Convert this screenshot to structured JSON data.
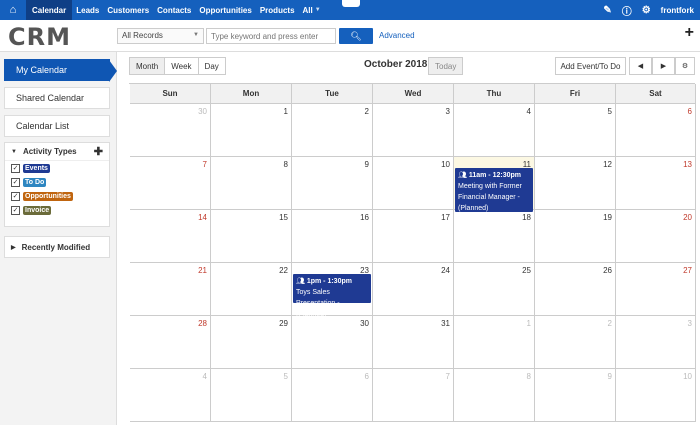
{
  "topnav": {
    "tabs": [
      {
        "label": "Calendar",
        "active": true
      },
      {
        "label": "Leads"
      },
      {
        "label": "Customers"
      },
      {
        "label": "Contacts"
      },
      {
        "label": "Opportunities"
      },
      {
        "label": "Products"
      },
      {
        "label": "All"
      }
    ],
    "user": "frontfork",
    "color": "#1560bd"
  },
  "header": {
    "logo": "CRM",
    "record_filter": "All Records",
    "search_placeholder": "Type keyword and press enter",
    "advanced_label": "Advanced"
  },
  "sidebar": {
    "buttons": [
      "My Calendar",
      "Shared Calendar",
      "Calendar List"
    ],
    "activity_types_title": "Activity Types",
    "activity_types": [
      {
        "label": "Events",
        "color": "#1f3a93",
        "checked": true
      },
      {
        "label": "To Do",
        "color": "#2e86c1",
        "checked": true
      },
      {
        "label": "Opportunities",
        "color": "#c0650f",
        "checked": true
      },
      {
        "label": "Invoice",
        "color": "#6b6b3a",
        "checked": true
      }
    ],
    "recently_modified": "Recently Modified"
  },
  "toolbar": {
    "views": [
      "Month",
      "Week",
      "Day"
    ],
    "active_view": "Month",
    "title": "October 2018",
    "today_label": "Today",
    "add_label": "Add Event/To Do",
    "prev": "◀",
    "next": "▶",
    "gear": "⚙"
  },
  "calendar": {
    "day_names": [
      "Sun",
      "Mon",
      "Tue",
      "Wed",
      "Thu",
      "Fri",
      "Sat"
    ],
    "weeks": [
      [
        "30",
        "1",
        "2",
        "3",
        "4",
        "5",
        "6"
      ],
      [
        "7",
        "8",
        "9",
        "10",
        "11",
        "12",
        "13"
      ],
      [
        "14",
        "15",
        "16",
        "17",
        "18",
        "19",
        "20"
      ],
      [
        "21",
        "22",
        "23",
        "24",
        "25",
        "26",
        "27"
      ],
      [
        "28",
        "29",
        "30",
        "31",
        "1",
        "2",
        "3"
      ],
      [
        "4",
        "5",
        "6",
        "7",
        "8",
        "9",
        "10"
      ]
    ],
    "events": [
      {
        "time": "11am - 12:30pm",
        "title": "Meeting with Former Financial Manager - (Planned)",
        "day": "11"
      },
      {
        "time": "1pm - 1:30pm",
        "title": "Toys Sales Presentation - (Planned)",
        "day": "23"
      }
    ]
  }
}
